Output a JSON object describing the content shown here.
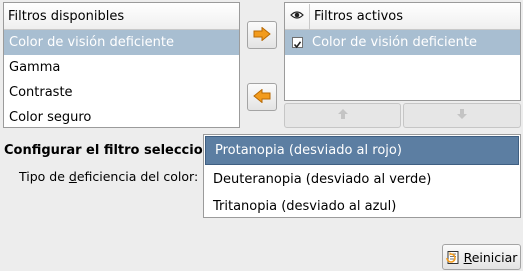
{
  "available_filters": {
    "header": "Filtros disponibles",
    "items": [
      "Color de visión deficiente",
      "Gamma",
      "Contraste",
      "Color seguro"
    ],
    "selected_index": 0
  },
  "active_filters": {
    "header": "Filtros activos",
    "items": [
      {
        "label": "Color de visión deficiente",
        "checked": true
      }
    ]
  },
  "config": {
    "title_visible": "Configurar el filtro seleccio",
    "deficiency_label_prefix": "Tipo de ",
    "deficiency_label_mnemonic": "d",
    "deficiency_label_suffix": "eficiencia del color:",
    "options": [
      "Protanopia (desviado al rojo)",
      "Deuteranopia (desviado al verde)",
      "Tritanopia (desviado al azul)"
    ],
    "selected_index": 0
  },
  "buttons": {
    "reset_mnemonic": "R",
    "reset_rest": "einiciar"
  },
  "colors": {
    "arrow_orange": "#f29b1d",
    "selection_light": "#a8bed1",
    "selection_dark": "#5c7ea2"
  }
}
